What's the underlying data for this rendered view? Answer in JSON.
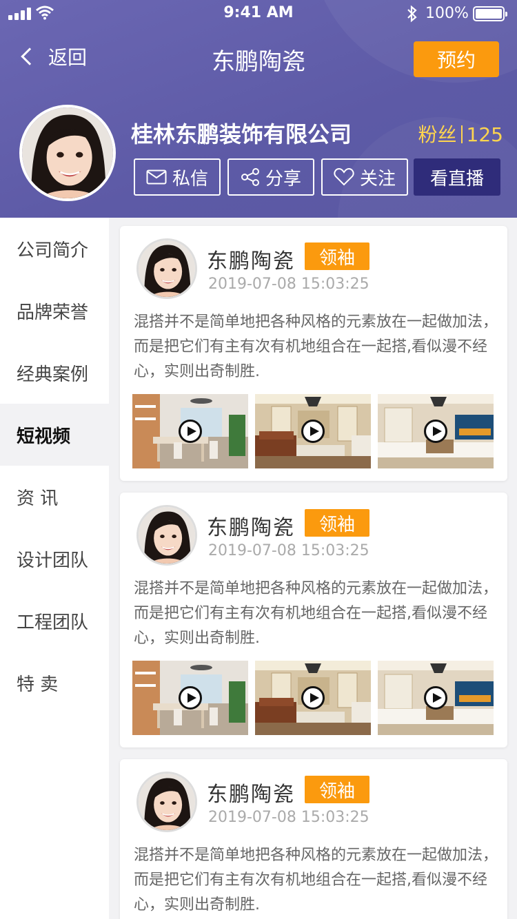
{
  "status_bar": {
    "time": "9:41 AM",
    "battery": "100%"
  },
  "nav": {
    "back_label": "返回",
    "title": "东鹏陶瓷",
    "reserve_label": "预约"
  },
  "company": {
    "name": "桂林东鹏装饰有限公司",
    "fans_label": "粉丝",
    "fans_count": "125"
  },
  "actions": {
    "message": "私信",
    "share": "分享",
    "follow": "关注",
    "live": "看直播"
  },
  "sidebar": {
    "items": [
      {
        "label": "公司简介"
      },
      {
        "label": "品牌荣誉"
      },
      {
        "label": "经典案例"
      },
      {
        "label": "短视频",
        "active": true
      },
      {
        "label": "资 讯"
      },
      {
        "label": "设计团队"
      },
      {
        "label": "工程团队"
      },
      {
        "label": "特 卖"
      }
    ]
  },
  "posts": [
    {
      "author": "东鹏陶瓷",
      "badge": "领袖",
      "date": "2019-07-08 15:03:25",
      "text": "混搭并不是简单地把各种风格的元素放在一起做加法，而是把它们有主有次有机地组合在一起搭,看似漫不经心，实则出奇制胜."
    },
    {
      "author": "东鹏陶瓷",
      "badge": "领袖",
      "date": "2019-07-08 15:03:25",
      "text": "混搭并不是简单地把各种风格的元素放在一起做加法，而是把它们有主有次有机地组合在一起搭,看似漫不经心，实则出奇制胜."
    },
    {
      "author": "东鹏陶瓷",
      "badge": "领袖",
      "date": "2019-07-08 15:03:25",
      "text": "混搭并不是简单地把各种风格的元素放在一起做加法，而是把它们有主有次有机地组合在一起搭,看似漫不经心，实则出奇制胜."
    }
  ],
  "colors": {
    "header": "#5d5aa6",
    "accent": "#fb9a0e",
    "live_button": "#2f2c7a",
    "fans": "#ffd54f"
  }
}
